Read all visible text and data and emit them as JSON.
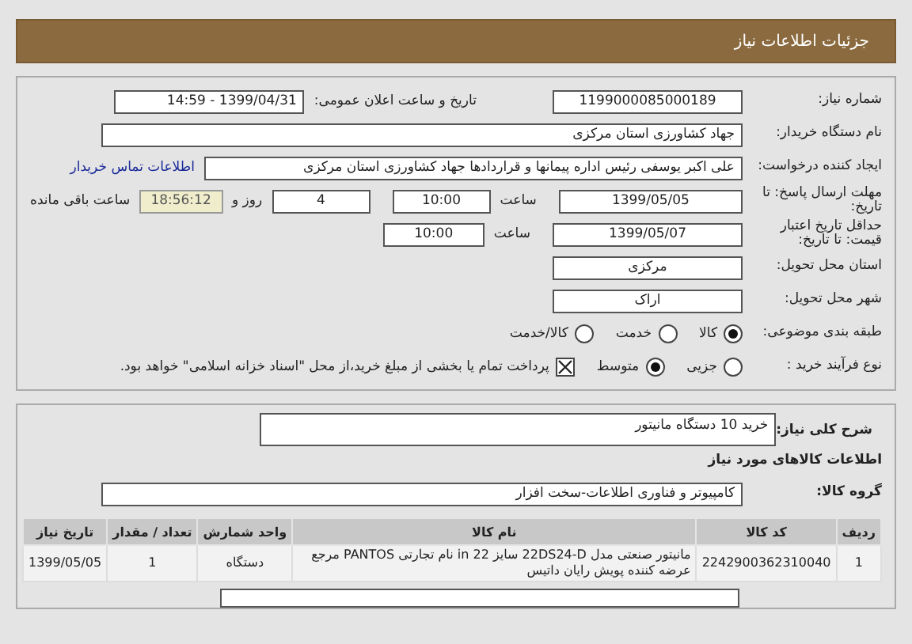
{
  "header": {
    "title": "جزئیات اطلاعات نیاز"
  },
  "need_number": {
    "label": "شماره نیاز:",
    "value": "1199000085000189"
  },
  "announce": {
    "label": "تاریخ و ساعت اعلان عمومی:",
    "value": "1399/04/31 - 14:59"
  },
  "buyer_org": {
    "label": "نام دستگاه خریدار:",
    "value": "جهاد کشاورزی استان مرکزی"
  },
  "requester": {
    "label": "ایجاد کننده درخواست:",
    "value": "علی اکبر یوسفی رئیس اداره پیمانها و قراردادها جهاد کشاورزی استان مرکزی",
    "link": "اطلاعات تماس خریدار"
  },
  "deadline": {
    "label": "مهلت ارسال پاسخ: تا تاریخ:",
    "date": "1399/05/05",
    "time_label": "ساعت",
    "time": "10:00",
    "days": "4",
    "days_label": "روز و",
    "remaining": "18:56:12",
    "remaining_label": "ساعت باقی مانده"
  },
  "price_validity": {
    "label": "حداقل تاریخ اعتبار قیمت: تا تاریخ:",
    "date": "1399/05/07",
    "time_label": "ساعت",
    "time": "10:00"
  },
  "province": {
    "label": "استان محل تحویل:",
    "value": "مرکزی"
  },
  "city": {
    "label": "شهر محل تحویل:",
    "value": "اراک"
  },
  "category": {
    "label": "طبقه بندی موضوعی:",
    "options": [
      {
        "label": "کالا",
        "selected": true
      },
      {
        "label": "خدمت",
        "selected": false
      },
      {
        "label": "کالا/خدمت",
        "selected": false
      }
    ]
  },
  "process": {
    "label": "نوع فرآیند خرید :",
    "options": [
      {
        "label": "جزیی",
        "selected": false
      },
      {
        "label": "متوسط",
        "selected": true
      }
    ],
    "treasury": {
      "label": "پرداخت تمام یا بخشی از مبلغ خرید،از محل \"اسناد خزانه اسلامی\" خواهد بود.",
      "checked": true
    }
  },
  "description": {
    "label": "شرح کلی نیاز:",
    "value": "خرید 10 دستگاه مانیتور"
  },
  "goods_heading": "اطلاعات کالاهای مورد نیاز",
  "goods_group": {
    "label": "گروه کالا:",
    "value": "کامپیوتر و فناوری اطلاعات-سخت افزار"
  },
  "table": {
    "columns": [
      "ردیف",
      "کد کالا",
      "نام کالا",
      "واحد شمارش",
      "تعداد / مقدار",
      "تاریخ نیاز"
    ],
    "rows": [
      [
        "1",
        "2242900362310040",
        "مانیتور صنعتی مدل 22DS24-D سایز 22 in نام تجارتی PANTOS مرجع عرضه کننده پویش رایان داتیس",
        "دستگاه",
        "1",
        "1399/05/05"
      ]
    ]
  }
}
